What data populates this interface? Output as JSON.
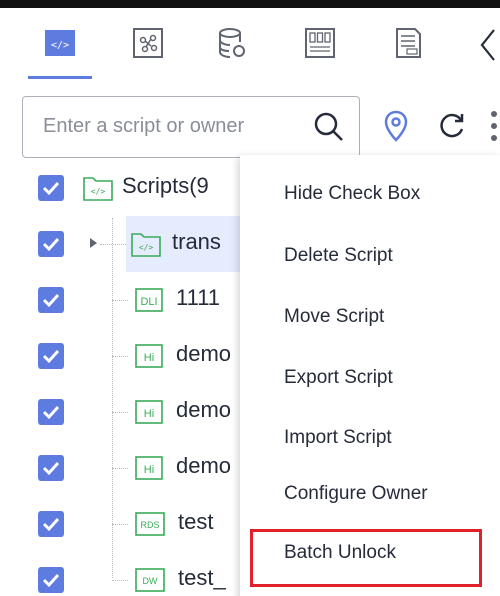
{
  "toolbar": {
    "tabs": [
      {
        "icon": "script-code-icon",
        "active": true
      },
      {
        "icon": "job-flow-icon",
        "active": false
      },
      {
        "icon": "database-icon",
        "active": false
      },
      {
        "icon": "table-grid-icon",
        "active": false
      },
      {
        "icon": "log-file-icon",
        "active": false
      }
    ],
    "collapse_icon": "chevron-left-icon"
  },
  "search": {
    "placeholder": "Enter a script or owner"
  },
  "actions": [
    "locate-icon",
    "refresh-icon",
    "more-icon"
  ],
  "tree": {
    "root": {
      "label": "Scripts(9",
      "icon": "folder-code-icon",
      "checked": true
    },
    "children": [
      {
        "label": "trans",
        "badge": "</>",
        "checked": true,
        "selected": true,
        "expandable": true
      },
      {
        "label": "1111",
        "badge": "DLI",
        "checked": true
      },
      {
        "label": "demo",
        "badge": "Hi",
        "checked": true
      },
      {
        "label": "demo",
        "badge": "Hi",
        "checked": true
      },
      {
        "label": "demo",
        "badge": "Hi",
        "checked": true
      },
      {
        "label": "test",
        "badge": "RDS",
        "checked": true
      },
      {
        "label": "test_",
        "badge": "DW",
        "checked": true
      }
    ]
  },
  "context_menu": {
    "items": [
      "Hide Check Box",
      "Delete Script",
      "Move Script",
      "Export Script",
      "Import Script",
      "Configure Owner",
      "Batch Unlock"
    ],
    "highlighted": "Batch Unlock"
  },
  "colors": {
    "accent": "#5e7ce0",
    "selected_row": "#e5ecfd",
    "icon_green": "#3aab5a",
    "highlight_border": "#e0202a"
  }
}
